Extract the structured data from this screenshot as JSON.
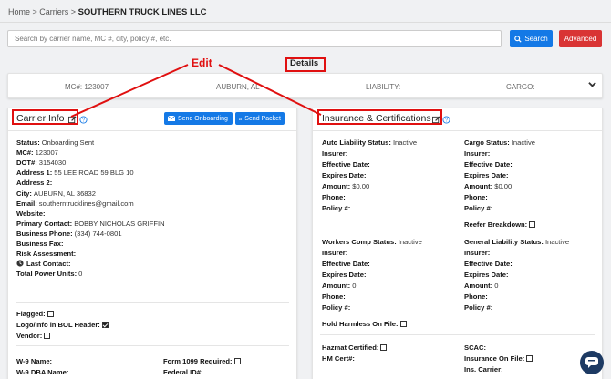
{
  "breadcrumb": {
    "home": "Home",
    "sep1": " > ",
    "carriers": "Carriers",
    "sep2": " > ",
    "current": "SOUTHERN TRUCK LINES LLC"
  },
  "search": {
    "placeholder": "Search by carrier name, MC #, city, policy #, etc.",
    "button": "Search",
    "advanced": "Advanced"
  },
  "annotations": {
    "edit": "Edit",
    "details": "Details"
  },
  "summary": {
    "mc": "MC#: 123007",
    "location": "AUBURN, AL",
    "liability": "LIABILITY:",
    "cargo": "CARGO:"
  },
  "carrier": {
    "title": "Carrier Info",
    "send_onboarding": "Send Onboarding",
    "send_packet": "Send Packet",
    "fields": [
      {
        "label": "Status:",
        "value": "Onboarding Sent"
      },
      {
        "label": "MC#:",
        "value": "123007"
      },
      {
        "label": "DOT#:",
        "value": "3154030"
      },
      {
        "label": "Address 1:",
        "value": "55 LEE ROAD 59 BLG 10"
      },
      {
        "label": "Address 2:",
        "value": ""
      },
      {
        "label": "City:",
        "value": "AUBURN, AL 36832"
      },
      {
        "label": "Email:",
        "value": "southerntrucklines@gmail.com"
      },
      {
        "label": "Website:",
        "value": ""
      },
      {
        "label": "Primary Contact:",
        "value": "BOBBY NICHOLAS GRIFFIN"
      },
      {
        "label": "Business Phone:",
        "value": "(334) 744-0801"
      },
      {
        "label": "Business Fax:",
        "value": ""
      },
      {
        "label": "Risk Assessment:",
        "value": ""
      },
      {
        "label": "Last Contact:",
        "value": ""
      },
      {
        "label": "Total Power Units:",
        "value": "0"
      }
    ],
    "flagged": "Flagged:",
    "logo_bol": "Logo/Info in BOL Header:",
    "vendor": "Vendor:",
    "w9_name": "W-9 Name:",
    "w9_dba": "W-9 DBA Name:",
    "form1099": "Form 1099 Required:",
    "federal_id": "Federal ID#:"
  },
  "insurance": {
    "title": "Insurance & Certifications",
    "auto": {
      "status_label": "Auto Liability Status:",
      "status_value": "Inactive",
      "insurer": "Insurer:",
      "effective": "Effective Date:",
      "expires": "Expires Date:",
      "amount_label": "Amount:",
      "amount_value": "$0.00",
      "phone": "Phone:",
      "policy": "Policy #:"
    },
    "cargo": {
      "status_label": "Cargo Status:",
      "status_value": "Inactive",
      "insurer": "Insurer:",
      "effective": "Effective Date:",
      "expires": "Expires Date:",
      "amount_label": "Amount:",
      "amount_value": "$0.00",
      "phone": "Phone:",
      "policy": "Policy #:",
      "reefer": "Reefer Breakdown:"
    },
    "workers": {
      "status_label": "Workers Comp Status:",
      "status_value": "Inactive",
      "insurer": "Insurer:",
      "effective": "Effective Date:",
      "expires": "Expires Date:",
      "amount_label": "Amount:",
      "amount_value": "0",
      "phone": "Phone:",
      "policy": "Policy #:",
      "hold": "Hold Harmless On File:"
    },
    "general": {
      "status_label": "General Liability Status:",
      "status_value": "Inactive",
      "insurer": "Insurer:",
      "effective": "Effective Date:",
      "expires": "Expires Date:",
      "amount_label": "Amount:",
      "amount_value": "0",
      "phone": "Phone:",
      "policy": "Policy #:"
    },
    "hazmat": "Hazmat Certified:",
    "hm_cert": "HM Cert#:",
    "scac": "SCAC:",
    "ins_on_file": "Insurance On File:",
    "ins_carrier": "Ins. Carrier:"
  },
  "colors": {
    "primary": "#1479e6",
    "danger": "#d93434",
    "annotation": "#e01010",
    "chat": "#1d3a63"
  }
}
